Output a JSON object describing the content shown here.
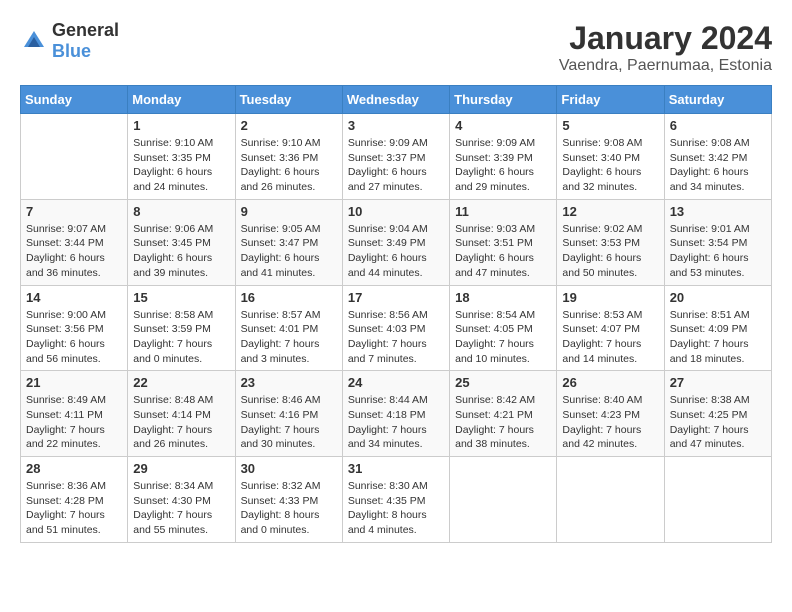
{
  "header": {
    "logo_general": "General",
    "logo_blue": "Blue",
    "title": "January 2024",
    "subtitle": "Vaendra, Paernumaa, Estonia"
  },
  "calendar": {
    "days_of_week": [
      "Sunday",
      "Monday",
      "Tuesday",
      "Wednesday",
      "Thursday",
      "Friday",
      "Saturday"
    ],
    "weeks": [
      [
        {
          "day": "",
          "info": ""
        },
        {
          "day": "1",
          "info": "Sunrise: 9:10 AM\nSunset: 3:35 PM\nDaylight: 6 hours\nand 24 minutes."
        },
        {
          "day": "2",
          "info": "Sunrise: 9:10 AM\nSunset: 3:36 PM\nDaylight: 6 hours\nand 26 minutes."
        },
        {
          "day": "3",
          "info": "Sunrise: 9:09 AM\nSunset: 3:37 PM\nDaylight: 6 hours\nand 27 minutes."
        },
        {
          "day": "4",
          "info": "Sunrise: 9:09 AM\nSunset: 3:39 PM\nDaylight: 6 hours\nand 29 minutes."
        },
        {
          "day": "5",
          "info": "Sunrise: 9:08 AM\nSunset: 3:40 PM\nDaylight: 6 hours\nand 32 minutes."
        },
        {
          "day": "6",
          "info": "Sunrise: 9:08 AM\nSunset: 3:42 PM\nDaylight: 6 hours\nand 34 minutes."
        }
      ],
      [
        {
          "day": "7",
          "info": "Sunrise: 9:07 AM\nSunset: 3:44 PM\nDaylight: 6 hours\nand 36 minutes."
        },
        {
          "day": "8",
          "info": "Sunrise: 9:06 AM\nSunset: 3:45 PM\nDaylight: 6 hours\nand 39 minutes."
        },
        {
          "day": "9",
          "info": "Sunrise: 9:05 AM\nSunset: 3:47 PM\nDaylight: 6 hours\nand 41 minutes."
        },
        {
          "day": "10",
          "info": "Sunrise: 9:04 AM\nSunset: 3:49 PM\nDaylight: 6 hours\nand 44 minutes."
        },
        {
          "day": "11",
          "info": "Sunrise: 9:03 AM\nSunset: 3:51 PM\nDaylight: 6 hours\nand 47 minutes."
        },
        {
          "day": "12",
          "info": "Sunrise: 9:02 AM\nSunset: 3:53 PM\nDaylight: 6 hours\nand 50 minutes."
        },
        {
          "day": "13",
          "info": "Sunrise: 9:01 AM\nSunset: 3:54 PM\nDaylight: 6 hours\nand 53 minutes."
        }
      ],
      [
        {
          "day": "14",
          "info": "Sunrise: 9:00 AM\nSunset: 3:56 PM\nDaylight: 6 hours\nand 56 minutes."
        },
        {
          "day": "15",
          "info": "Sunrise: 8:58 AM\nSunset: 3:59 PM\nDaylight: 7 hours\nand 0 minutes."
        },
        {
          "day": "16",
          "info": "Sunrise: 8:57 AM\nSunset: 4:01 PM\nDaylight: 7 hours\nand 3 minutes."
        },
        {
          "day": "17",
          "info": "Sunrise: 8:56 AM\nSunset: 4:03 PM\nDaylight: 7 hours\nand 7 minutes."
        },
        {
          "day": "18",
          "info": "Sunrise: 8:54 AM\nSunset: 4:05 PM\nDaylight: 7 hours\nand 10 minutes."
        },
        {
          "day": "19",
          "info": "Sunrise: 8:53 AM\nSunset: 4:07 PM\nDaylight: 7 hours\nand 14 minutes."
        },
        {
          "day": "20",
          "info": "Sunrise: 8:51 AM\nSunset: 4:09 PM\nDaylight: 7 hours\nand 18 minutes."
        }
      ],
      [
        {
          "day": "21",
          "info": "Sunrise: 8:49 AM\nSunset: 4:11 PM\nDaylight: 7 hours\nand 22 minutes."
        },
        {
          "day": "22",
          "info": "Sunrise: 8:48 AM\nSunset: 4:14 PM\nDaylight: 7 hours\nand 26 minutes."
        },
        {
          "day": "23",
          "info": "Sunrise: 8:46 AM\nSunset: 4:16 PM\nDaylight: 7 hours\nand 30 minutes."
        },
        {
          "day": "24",
          "info": "Sunrise: 8:44 AM\nSunset: 4:18 PM\nDaylight: 7 hours\nand 34 minutes."
        },
        {
          "day": "25",
          "info": "Sunrise: 8:42 AM\nSunset: 4:21 PM\nDaylight: 7 hours\nand 38 minutes."
        },
        {
          "day": "26",
          "info": "Sunrise: 8:40 AM\nSunset: 4:23 PM\nDaylight: 7 hours\nand 42 minutes."
        },
        {
          "day": "27",
          "info": "Sunrise: 8:38 AM\nSunset: 4:25 PM\nDaylight: 7 hours\nand 47 minutes."
        }
      ],
      [
        {
          "day": "28",
          "info": "Sunrise: 8:36 AM\nSunset: 4:28 PM\nDaylight: 7 hours\nand 51 minutes."
        },
        {
          "day": "29",
          "info": "Sunrise: 8:34 AM\nSunset: 4:30 PM\nDaylight: 7 hours\nand 55 minutes."
        },
        {
          "day": "30",
          "info": "Sunrise: 8:32 AM\nSunset: 4:33 PM\nDaylight: 8 hours\nand 0 minutes."
        },
        {
          "day": "31",
          "info": "Sunrise: 8:30 AM\nSunset: 4:35 PM\nDaylight: 8 hours\nand 4 minutes."
        },
        {
          "day": "",
          "info": ""
        },
        {
          "day": "",
          "info": ""
        },
        {
          "day": "",
          "info": ""
        }
      ]
    ]
  }
}
